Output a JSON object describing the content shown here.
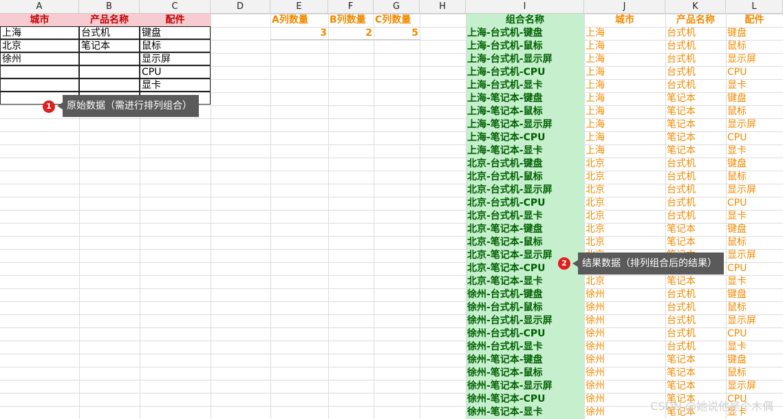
{
  "columns": [
    "A",
    "B",
    "C",
    "D",
    "E",
    "F",
    "G",
    "H",
    "I",
    "J",
    "K",
    "L"
  ],
  "source_headers": {
    "city": "城市",
    "product": "产品名称",
    "part": "配件"
  },
  "source_rows": [
    [
      "上海",
      "台式机",
      "键盘"
    ],
    [
      "北京",
      "笔记本",
      "鼠标"
    ],
    [
      "徐州",
      "",
      "显示屏"
    ],
    [
      "",
      "",
      "CPU"
    ],
    [
      "",
      "",
      "显卡"
    ]
  ],
  "count_headers": [
    "A列数量",
    "B列数量",
    "C列数量"
  ],
  "counts": [
    "3",
    "2",
    "5"
  ],
  "result_headers": {
    "combo": "组合名称",
    "city": "城市",
    "product": "产品名称",
    "part": "配件"
  },
  "results": [
    [
      "上海-台式机-键盘",
      "上海",
      "台式机",
      "键盘"
    ],
    [
      "上海-台式机-鼠标",
      "上海",
      "台式机",
      "鼠标"
    ],
    [
      "上海-台式机-显示屏",
      "上海",
      "台式机",
      "显示屏"
    ],
    [
      "上海-台式机-CPU",
      "上海",
      "台式机",
      "CPU"
    ],
    [
      "上海-台式机-显卡",
      "上海",
      "台式机",
      "显卡"
    ],
    [
      "上海-笔记本-键盘",
      "上海",
      "笔记本",
      "键盘"
    ],
    [
      "上海-笔记本-鼠标",
      "上海",
      "笔记本",
      "鼠标"
    ],
    [
      "上海-笔记本-显示屏",
      "上海",
      "笔记本",
      "显示屏"
    ],
    [
      "上海-笔记本-CPU",
      "上海",
      "笔记本",
      "CPU"
    ],
    [
      "上海-笔记本-显卡",
      "上海",
      "笔记本",
      "显卡"
    ],
    [
      "北京-台式机-键盘",
      "北京",
      "台式机",
      "键盘"
    ],
    [
      "北京-台式机-鼠标",
      "北京",
      "台式机",
      "鼠标"
    ],
    [
      "北京-台式机-显示屏",
      "北京",
      "台式机",
      "显示屏"
    ],
    [
      "北京-台式机-CPU",
      "北京",
      "台式机",
      "CPU"
    ],
    [
      "北京-台式机-显卡",
      "北京",
      "台式机",
      "显卡"
    ],
    [
      "北京-笔记本-键盘",
      "北京",
      "笔记本",
      "键盘"
    ],
    [
      "北京-笔记本-鼠标",
      "北京",
      "笔记本",
      "鼠标"
    ],
    [
      "北京-笔记本-显示屏",
      "北京",
      "笔记本",
      "显示屏"
    ],
    [
      "北京-笔记本-CPU",
      "北京",
      "笔记本",
      "CPU"
    ],
    [
      "北京-笔记本-显卡",
      "北京",
      "笔记本",
      "显卡"
    ],
    [
      "徐州-台式机-键盘",
      "徐州",
      "台式机",
      "键盘"
    ],
    [
      "徐州-台式机-鼠标",
      "徐州",
      "台式机",
      "鼠标"
    ],
    [
      "徐州-台式机-显示屏",
      "徐州",
      "台式机",
      "显示屏"
    ],
    [
      "徐州-台式机-CPU",
      "徐州",
      "台式机",
      "CPU"
    ],
    [
      "徐州-台式机-显卡",
      "徐州",
      "台式机",
      "显卡"
    ],
    [
      "徐州-笔记本-键盘",
      "徐州",
      "笔记本",
      "键盘"
    ],
    [
      "徐州-笔记本-鼠标",
      "徐州",
      "笔记本",
      "鼠标"
    ],
    [
      "徐州-笔记本-显示屏",
      "徐州",
      "笔记本",
      "显示屏"
    ],
    [
      "徐州-笔记本-CPU",
      "徐州",
      "笔记本",
      "CPU"
    ],
    [
      "徐州-笔记本-显卡",
      "徐州",
      "笔记本",
      "显卡"
    ]
  ],
  "callouts": [
    {
      "num": "1",
      "text": "原始数据（需进行排列组合）"
    },
    {
      "num": "2",
      "text": "结果数据（排列组合后的结果）"
    }
  ],
  "watermark": "CSDN @她说他是个木偶",
  "colors": {
    "header_pink": "#f8cbd0",
    "header_red": "#c00000",
    "orange": "#f08a00",
    "green_fill": "#c6efce",
    "green_text": "#006100"
  }
}
